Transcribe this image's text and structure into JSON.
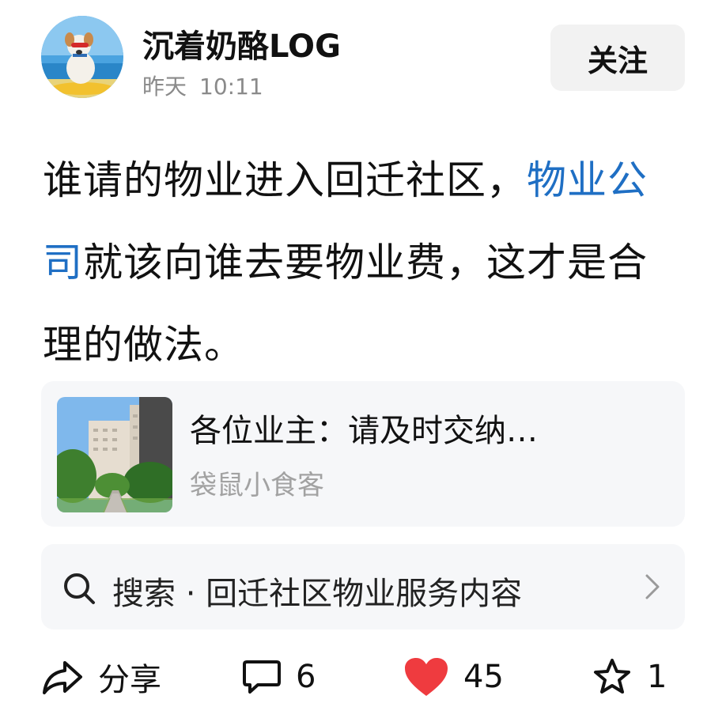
{
  "header": {
    "username": "沉着奶酪LOG",
    "time_day": "昨天",
    "time_clock": "10:11",
    "follow_label": "关注"
  },
  "post": {
    "text_before": "谁请的物业进入回迁社区，",
    "tag": "物业公司",
    "text_after": "就该向谁去要物业费，这才是合理的做法。"
  },
  "link_card": {
    "title": "各位业主：请及时交纳…",
    "source": "袋鼠小食客"
  },
  "search": {
    "label": "搜索 · 回迁社区物业服务内容"
  },
  "actions": {
    "share_label": "分享",
    "comment_count": "6",
    "like_count": "45",
    "favorite_count": "1"
  },
  "colors": {
    "tag": "#1f6fc4",
    "like": "#ef3b3f",
    "card_bg": "#f6f7f9"
  },
  "icons": [
    "search-icon",
    "chevron-right-icon",
    "share-icon",
    "comment-icon",
    "heart-icon",
    "star-icon"
  ]
}
